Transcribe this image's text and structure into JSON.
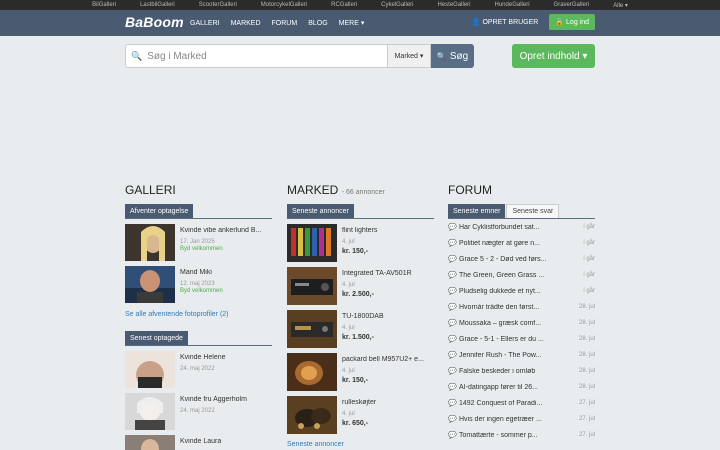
{
  "topnet": [
    "BilGalleri",
    "LastbilGalleri",
    "ScooterGalleri",
    "MotorcykelGalleri",
    "RCGalleri",
    "CykelGalleri",
    "HesteGalleri",
    "HundeGalleri",
    "GraverGalleri",
    "Alle ▾"
  ],
  "brand": "BaBoom",
  "nav": {
    "galleri": "GALLERI",
    "marked": "MARKED",
    "forum": "FORUM",
    "blog": "BLOG",
    "mere": "MERE ▾",
    "opret_bruger": "OPRET BRUGER",
    "login": "Log ind"
  },
  "search": {
    "placeholder": "Søg i Marked",
    "category": "Marked ▾",
    "button": "Søg"
  },
  "opret_indhold": "Opret indhold ▾",
  "galleri": {
    "title": "GALLERI",
    "tab_pending": "Afventer optagelse",
    "pending": [
      {
        "name": "Kvinde vibe ankerlund B...",
        "date": "17. Jan 2025",
        "status": "Byd velkommen"
      },
      {
        "name": "Mand Miki",
        "date": "12. maj 2023",
        "status": "Byd velkommen"
      }
    ],
    "more_link": "Se alle afventende fotoprofiler (2)",
    "tab_latest": "Senest optagede",
    "latest": [
      {
        "name": "Kvinde Helene",
        "date": "24. maj 2022"
      },
      {
        "name": "Kvinde fru Aggerholm",
        "date": "24. maj 2022"
      },
      {
        "name": "Kvinde Laura",
        "date": ""
      }
    ]
  },
  "marked": {
    "title": "MARKED",
    "count": "- 66 annoncer",
    "tab": "Seneste annoncer",
    "items": [
      {
        "name": "flint lighters",
        "date": "4. jul",
        "price": "kr. 150,-"
      },
      {
        "name": "Integrated TA-AV501R",
        "date": "4. jul",
        "price": "kr. 2.500,-"
      },
      {
        "name": "TU-1800DAB",
        "date": "4. jul",
        "price": "kr. 1.500,-"
      },
      {
        "name": "packard bell M957U2+ e...",
        "date": "4. jul",
        "price": "kr. 150,-"
      },
      {
        "name": "rulleskøjter",
        "date": "4. jul",
        "price": "kr. 650,-"
      }
    ],
    "more_link": "Seneste annoncer"
  },
  "forum": {
    "title": "FORUM",
    "tab_topics": "Seneste emner",
    "tab_replies": "Seneste svar",
    "items": [
      {
        "title": "Har Cyklistforbundet sat...",
        "date": "i går"
      },
      {
        "title": "Politiet nægter at gøre n...",
        "date": "i går"
      },
      {
        "title": "Grace 5 - 2 - Død ved førs...",
        "date": "i går"
      },
      {
        "title": "The Green, Green Grass ...",
        "date": "i går"
      },
      {
        "title": "Pludselig dukkede et nyt...",
        "date": "i går"
      },
      {
        "title": "Hvornår trådte den først...",
        "date": "28. jul"
      },
      {
        "title": "Moussaka – græsk comf...",
        "date": "28. jul"
      },
      {
        "title": "Grace - 5-1 - Ellers er du ...",
        "date": "28. jul"
      },
      {
        "title": "Jennifer Rush - The Pow...",
        "date": "28. jul"
      },
      {
        "title": "Falske beskeder i omløb",
        "date": "28. jul"
      },
      {
        "title": "AI-datingapp fører til 26...",
        "date": "28. jul"
      },
      {
        "title": "1492 Conquest of Paradi...",
        "date": "27. jul"
      },
      {
        "title": "Hvis der ingen egetræer ...",
        "date": "27. jul"
      },
      {
        "title": "Tomattærte - sommer p...",
        "date": "27. jul"
      }
    ]
  }
}
